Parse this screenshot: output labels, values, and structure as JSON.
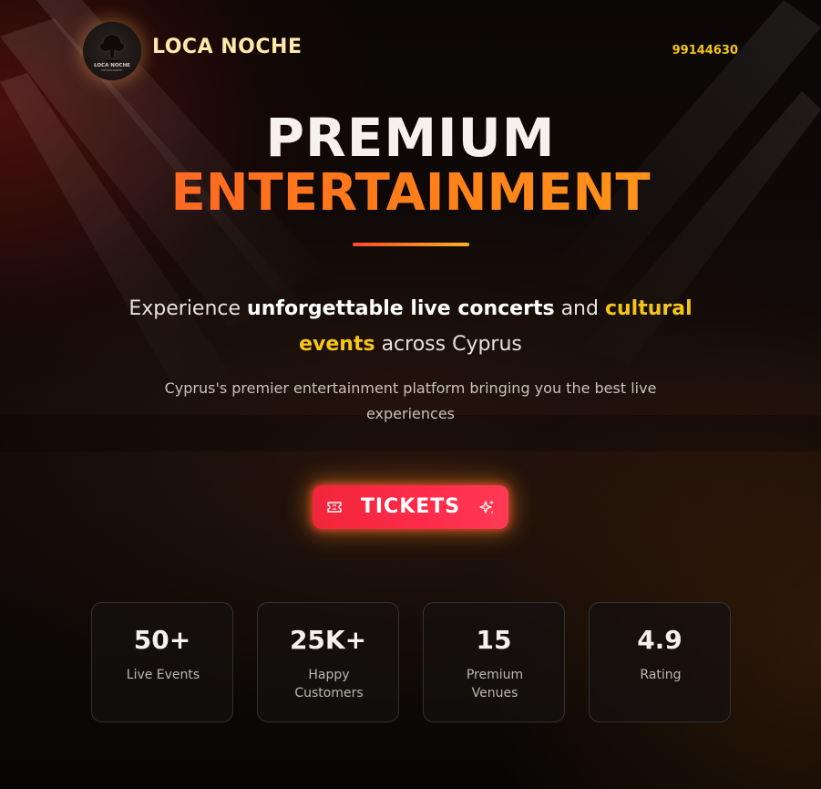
{
  "header": {
    "brand": "LOCA NOCHE",
    "logo_text": "LOCA NOCHE",
    "logo_subtext": "ENTERTAINMENT",
    "phone": "99144630"
  },
  "hero": {
    "title_line1": "PREMIUM",
    "title_line2": "ENTERTAINMENT",
    "tagline": {
      "part1": "Experience ",
      "highlight1": "unforgettable live concerts",
      "part2": " and ",
      "highlight2": "cultural events",
      "part3": " across Cyprus"
    },
    "subtext": "Cyprus's premier entertainment platform bringing you the best live experiences"
  },
  "cta": {
    "label": "TICKETS",
    "icon_left": "ticket-icon",
    "icon_right": "sparkles-icon"
  },
  "stats": [
    {
      "value": "50+",
      "label": "Live Events"
    },
    {
      "value": "25K+",
      "label": "Happy Customers"
    },
    {
      "value": "15",
      "label": "Premium Venues"
    },
    {
      "value": "4.9",
      "label": "Rating"
    }
  ],
  "colors": {
    "background": "#0b0706",
    "brand_gold": "#ffe9a8",
    "accent_gold": "#f5c518",
    "accent_orange": "#ff7a1a",
    "accent_red": "#ff2a4a",
    "text_light": "#f6f1ec"
  }
}
